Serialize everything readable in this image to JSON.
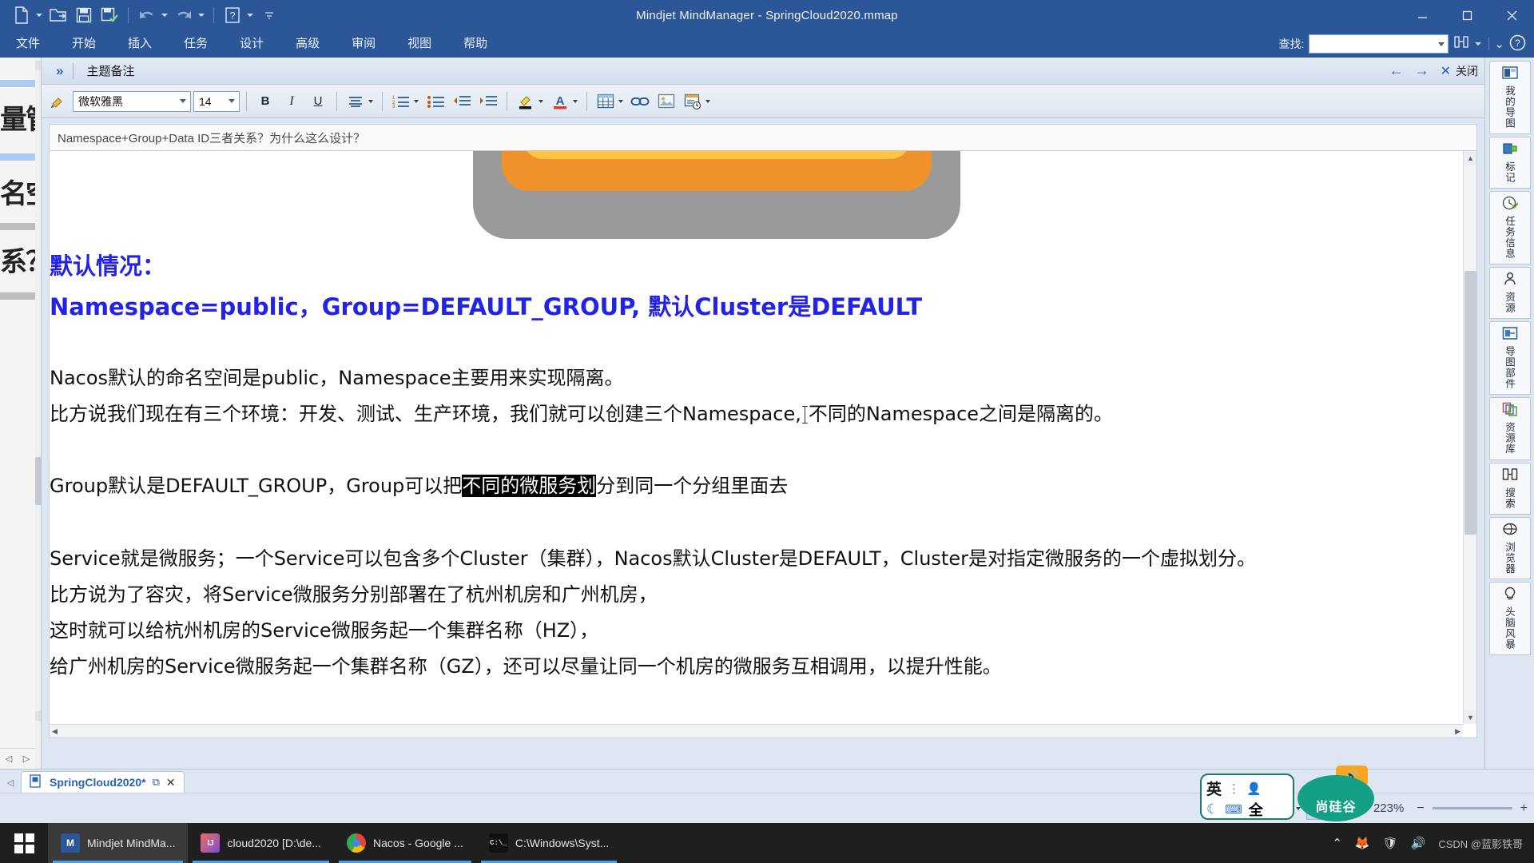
{
  "window": {
    "title": "Mindjet MindManager - SpringCloud2020.mmap",
    "minimize": "−",
    "maximize": "▢",
    "close": "✕"
  },
  "quick_access": {
    "new_label": "🗎",
    "open_label": "📂",
    "save_label": "💾",
    "saveas_label": "🖫",
    "undo_label": "↶",
    "redo_label": "↷",
    "help_label": "?",
    "more_label": "▾"
  },
  "menu": {
    "items": [
      {
        "label": "文件"
      },
      {
        "label": "开始"
      },
      {
        "label": "插入"
      },
      {
        "label": "任务"
      },
      {
        "label": "设计"
      },
      {
        "label": "高级"
      },
      {
        "label": "审阅"
      },
      {
        "label": "视图"
      },
      {
        "label": "帮助"
      }
    ],
    "find_label": "查找:",
    "find_value": "",
    "find_placeholder": "",
    "search_icon_label": "搜",
    "help_icon_label": "?"
  },
  "notes_panel": {
    "expand_label": "»",
    "title": "主题备注",
    "back_label": "←",
    "forward_label": "→",
    "close_label": "关闭",
    "close_x": "✕",
    "doc_title": "Namespace+Group+Data ID三者关系？为什么这么设计？"
  },
  "format_toolbar": {
    "format_painter_label": "🖌",
    "font_name": "微软雅黑",
    "font_size": "14",
    "bold_label": "B",
    "italic_label": "I",
    "underline_label": "U",
    "align_label": "≡",
    "numbered_list_label": "⒈≡",
    "bullet_list_label": "•≡",
    "outdent_label": "⇤≡",
    "indent_label": "⇥≡",
    "highlight_label": "🖊",
    "font_color_label": "A",
    "table_label": "▦",
    "link_label": "🔗",
    "image_label": "🖼",
    "object_label": "🗔"
  },
  "document": {
    "blue_heading": "默认情况：",
    "blue_line": "Namespace=public，Group=DEFAULT_GROUP, 默认Cluster是DEFAULT",
    "para1": "Nacos默认的命名空间是public，Namespace主要用来实现隔离。",
    "para2_before": "比方说我们现在有三个环境：开发、测试、生产环境，我们就可以创建三个Namespace,",
    "para2_after": "不同的Namespace之间是隔离的。",
    "para3_before": "Group默认是DEFAULT_GROUP，Group可以把",
    "para3_selected": "不同的微服务划",
    "para3_after": "分到同一个分组里面去",
    "para4": "Service就是微服务；一个Service可以包含多个Cluster（集群），Nacos默认Cluster是DEFAULT，Cluster是对指定微服务的一个虚拟划分。",
    "para5": "比方说为了容灾，将Service微服务分别部署在了杭州机房和广州机房，",
    "para6": "这时就可以给杭州机房的Service微服务起一个集群名称（HZ），",
    "para7": "给广州机房的Service微服务起一个集群名称（GZ），还可以尽量让同一个机房的微服务互相调用，以提升性能。",
    "scroll_up": "▲",
    "scroll_down": "▼",
    "scroll_left": "◀",
    "scroll_right": "▶"
  },
  "left_rail": {
    "clipped_rows": [
      "量管",
      "名空",
      "系？"
    ],
    "prev_label": "◁",
    "next_label": "▷"
  },
  "right_rail": {
    "items": [
      {
        "label": "我的导图",
        "icon": "🗂"
      },
      {
        "label": "标记",
        "icon": "🏷"
      },
      {
        "label": "任务信息",
        "icon": "🕐"
      },
      {
        "label": "资源",
        "icon": "👤"
      },
      {
        "label": "导图部件",
        "icon": "🖽"
      },
      {
        "label": "资源库",
        "icon": "🗃"
      },
      {
        "label": "搜索",
        "icon": "🔍"
      },
      {
        "label": "浏览器",
        "icon": "🌐"
      },
      {
        "label": "头脑风暴",
        "icon": "💡"
      }
    ]
  },
  "tabbar": {
    "prev_label": "◁",
    "tab_icon": "🗎",
    "tab_name": "SpringCloud2020*",
    "restore_label": "⧉",
    "close_label": "✕"
  },
  "statusbar": {
    "outline_label": "▤",
    "filter_label": "▼",
    "focus_label": "⊕",
    "fit_label": "⛶",
    "detail_label": "▤",
    "zoom_percent": "223%",
    "zoom_out": "−",
    "zoom_in": "+"
  },
  "ime": {
    "lang": "英",
    "dots": "⋮",
    "user": "👤",
    "moon": "☾",
    "keyboard": "⌨",
    "width_mode": "全"
  },
  "brand": {
    "bubble_text": "尚硅谷",
    "speaker": "🔊"
  },
  "taskbar": {
    "items": [
      {
        "label": "Mindjet MindMa...",
        "icon": "M",
        "color": "#2b5697",
        "active": true
      },
      {
        "label": "cloud2020 [D:\\de...",
        "icon": "IJ",
        "color": "#f26b5e",
        "active": false
      },
      {
        "label": "Nacos - Google ...",
        "icon": "O",
        "color": "#e8e8e8",
        "active": false
      },
      {
        "label": "C:\\Windows\\Syst...",
        "icon": "▮",
        "color": "#111111",
        "active": false
      }
    ],
    "tray": {
      "chevron": "⌃",
      "flame": "🦊",
      "shield": "🛡",
      "volume": "🔊",
      "watermark": "CSDN @蓝影铁哥"
    }
  },
  "colors": {
    "titlebar": "#2b5697",
    "panel": "#dde6f1",
    "accent_blue": "#2323e8",
    "selection": "#000000",
    "taskbar": "#1f1f1f"
  }
}
